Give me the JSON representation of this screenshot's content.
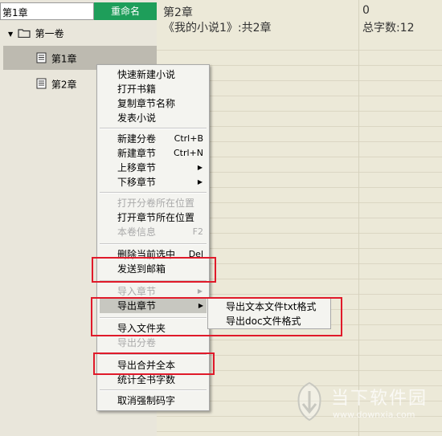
{
  "rename": {
    "input_value": "第1章",
    "button_label": "重命名"
  },
  "tree": {
    "volume": "第一卷",
    "chapter1": "第1章",
    "chapter2": "第2章"
  },
  "header": {
    "chapter_title": "第2章",
    "count_value": "0",
    "book_info": "《我的小说1》:共2章",
    "word_count": "总字数:12"
  },
  "menu": {
    "items": [
      {
        "label": "快速新建小说"
      },
      {
        "label": "打开书籍"
      },
      {
        "label": "复制章节名称"
      },
      {
        "label": "发表小说"
      },
      {
        "label": "新建分卷",
        "shortcut": "Ctrl+B"
      },
      {
        "label": "新建章节",
        "shortcut": "Ctrl+N"
      },
      {
        "label": "上移章节"
      },
      {
        "label": "下移章节"
      },
      {
        "label": "打开分卷所在位置",
        "disabled": true
      },
      {
        "label": "打开章节所在位置"
      },
      {
        "label": "本卷信息",
        "shortcut": "F2",
        "disabled": true
      },
      {
        "label": "删除当前选中",
        "shortcut": "Del"
      },
      {
        "label": "发送到邮箱"
      },
      {
        "label": "导入章节",
        "disabled": true
      },
      {
        "label": "导出章节",
        "highlighted": true
      },
      {
        "label": "导入文件夹"
      },
      {
        "label": "导出分卷",
        "disabled": true
      },
      {
        "label": "导出合并全本"
      },
      {
        "label": "统计全书字数"
      },
      {
        "label": "取消强制码字"
      }
    ]
  },
  "submenu": {
    "items": [
      {
        "label": "导出文本文件txt格式"
      },
      {
        "label": "导出doc文件格式"
      }
    ]
  },
  "watermark": {
    "title": "当下软件园",
    "url": "www.downxia.com"
  },
  "colors": {
    "accent_green": "#1e9e5a",
    "highlight_red": "#e01a2a"
  }
}
